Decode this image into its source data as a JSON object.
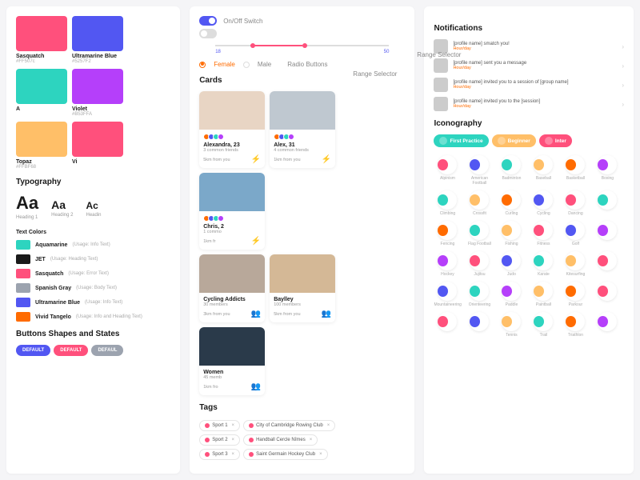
{
  "swatches": [
    {
      "name": "Sasquatch",
      "hex": "#FF507c",
      "color": "#FF507C"
    },
    {
      "name": "Ultramarine Blue",
      "hex": "#5257F2",
      "color": "#5257F2"
    },
    {
      "name": "A",
      "hex": "",
      "color": "#2DD4BF"
    },
    {
      "name": "Violet",
      "hex": "#B53FFA",
      "color": "#B53FFA"
    },
    {
      "name": "Topaz",
      "hex": "#FFBF68",
      "color": "#FFBF68"
    },
    {
      "name": "Vi",
      "hex": "",
      "color": "#FF507C"
    }
  ],
  "typography": {
    "title": "Typography",
    "items": [
      {
        "sample": "Aa",
        "size": "22px",
        "label": "Heading 1"
      },
      {
        "sample": "Aa",
        "size": "14px",
        "label": "Heading 2"
      },
      {
        "sample": "Ac",
        "size": "12px",
        "label": "Headin"
      }
    ]
  },
  "text_colors": {
    "title": "Text Colors",
    "items": [
      {
        "color": "#2DD4BF",
        "name": "Aquamarine",
        "usage": "(Usage: Info Text)"
      },
      {
        "color": "#1a1a1a",
        "name": "JET",
        "usage": "(Usage: Heading Text)"
      },
      {
        "color": "#FF507C",
        "name": "Sasquatch",
        "usage": "(Usage: Error Text)"
      },
      {
        "color": "#9CA3AF",
        "name": "Spanish Gray",
        "usage": "(Usage: Body Text)"
      },
      {
        "color": "#5257F2",
        "name": "Ultramarine Blue",
        "usage": "(Usage: Info Text)"
      },
      {
        "color": "#FF6B00",
        "name": "Vivid Tangelo",
        "usage": "(Usage: Info and Heading Text)"
      }
    ]
  },
  "buttons": {
    "title": "Buttons Shapes and States",
    "items": [
      {
        "label": "DEFAULT",
        "bg": "#5257F2"
      },
      {
        "label": "DEFAULT",
        "bg": "#FF507C"
      },
      {
        "label": "DEFAUL",
        "bg": "#9CA3AF"
      }
    ]
  },
  "controls": {
    "switch_label": "On/Off Switch",
    "range_label": "Range Selector",
    "range_min": "18",
    "range_max": "50",
    "radio_label": "Radio Buttons",
    "radio_female": "Female",
    "radio_male": "Male"
  },
  "cards": {
    "title": "Cards",
    "people": [
      {
        "name": "Alexandra, 23",
        "friends": "3 common friends",
        "dist": "5km from you",
        "img": "#e8d5c4"
      },
      {
        "name": "Alex, 31",
        "friends": "4 common friends",
        "dist": "1km from you",
        "img": "#bfc8d0",
        "badge": "power"
      },
      {
        "name": "Chris, 2",
        "friends": "1 commo",
        "dist": "1km fr",
        "img": "#7ba8c9"
      }
    ],
    "groups": [
      {
        "name": "Cycling Addicts",
        "members": "30 members",
        "dist": "3km from you",
        "img": "#b8a89a"
      },
      {
        "name": "Baylley",
        "members": "100 members",
        "dist": "5km from you",
        "img": "#d4b896"
      },
      {
        "name": "Women",
        "members": "45 memb",
        "dist": "1km fro",
        "img": "#2a3a4a"
      }
    ]
  },
  "tags": {
    "title": "Tags",
    "rows": [
      [
        {
          "label": "Sport 1"
        },
        {
          "label": "City of Cambridge Rowing Club",
          "icon": true
        }
      ],
      [
        {
          "label": "Sport 2"
        },
        {
          "label": "Handball Cercle Nîmes",
          "icon": true
        }
      ],
      [
        {
          "label": "Sport 3"
        },
        {
          "label": "Saint Germain Hockey Club",
          "icon": true
        }
      ]
    ]
  },
  "notifications": {
    "title": "Notifications",
    "items": [
      {
        "text": "[profile name] smatch you!",
        "time": "Hour/day"
      },
      {
        "text": "[profile name] sent you a message",
        "time": "Hour/day"
      },
      {
        "text": "[profile name] invited you to a session of [group name]",
        "time": "Hour/day"
      },
      {
        "text": "[profile name] invited you to the [session]",
        "time": "Hour/day"
      }
    ]
  },
  "iconography": {
    "title": "Iconography",
    "levels": [
      {
        "label": "First Practice",
        "bg": "#2DD4BF"
      },
      {
        "label": "Beginner",
        "bg": "#FFBF68"
      },
      {
        "label": "Inter",
        "bg": "#FF507C"
      }
    ],
    "icons": [
      {
        "label": "Alpinism",
        "c": "#FF507C"
      },
      {
        "label": "American Football",
        "c": "#5257F2"
      },
      {
        "label": "Badminton",
        "c": "#2DD4BF"
      },
      {
        "label": "Baseball",
        "c": "#FFBF68"
      },
      {
        "label": "Basketball",
        "c": "#FF6B00"
      },
      {
        "label": "Boxing",
        "c": "#B53FFA"
      },
      {
        "label": "Climbing",
        "c": "#2DD4BF"
      },
      {
        "label": "Crossfit",
        "c": "#FFBF68"
      },
      {
        "label": "Curling",
        "c": "#FF6B00"
      },
      {
        "label": "Cycling",
        "c": "#5257F2"
      },
      {
        "label": "Dancing",
        "c": "#FF507C"
      },
      {
        "label": "",
        "c": "#2DD4BF"
      },
      {
        "label": "Fencing",
        "c": "#FF6B00"
      },
      {
        "label": "Flag Football",
        "c": "#2DD4BF"
      },
      {
        "label": "Fishing",
        "c": "#FFBF68"
      },
      {
        "label": "Fitness",
        "c": "#FF507C"
      },
      {
        "label": "Golf",
        "c": "#5257F2"
      },
      {
        "label": "",
        "c": "#B53FFA"
      },
      {
        "label": "Hockey",
        "c": "#B53FFA"
      },
      {
        "label": "Jujitsu",
        "c": "#FF507C"
      },
      {
        "label": "Judo",
        "c": "#5257F2"
      },
      {
        "label": "Karate",
        "c": "#2DD4BF"
      },
      {
        "label": "Kitesurfing",
        "c": "#FFBF68"
      },
      {
        "label": "",
        "c": "#FF507C"
      },
      {
        "label": "Mountaineering",
        "c": "#5257F2"
      },
      {
        "label": "Orienteering",
        "c": "#2DD4BF"
      },
      {
        "label": "Paddle",
        "c": "#B53FFA"
      },
      {
        "label": "Paintball",
        "c": "#FFBF68"
      },
      {
        "label": "Parkour",
        "c": "#FF6B00"
      },
      {
        "label": "",
        "c": "#FF507C"
      },
      {
        "label": "",
        "c": "#FF507C"
      },
      {
        "label": "",
        "c": "#5257F2"
      },
      {
        "label": "Tennis",
        "c": "#FFBF68"
      },
      {
        "label": "Trail",
        "c": "#2DD4BF"
      },
      {
        "label": "Triathlon",
        "c": "#FF6B00"
      },
      {
        "label": "",
        "c": "#B53FFA"
      }
    ]
  }
}
